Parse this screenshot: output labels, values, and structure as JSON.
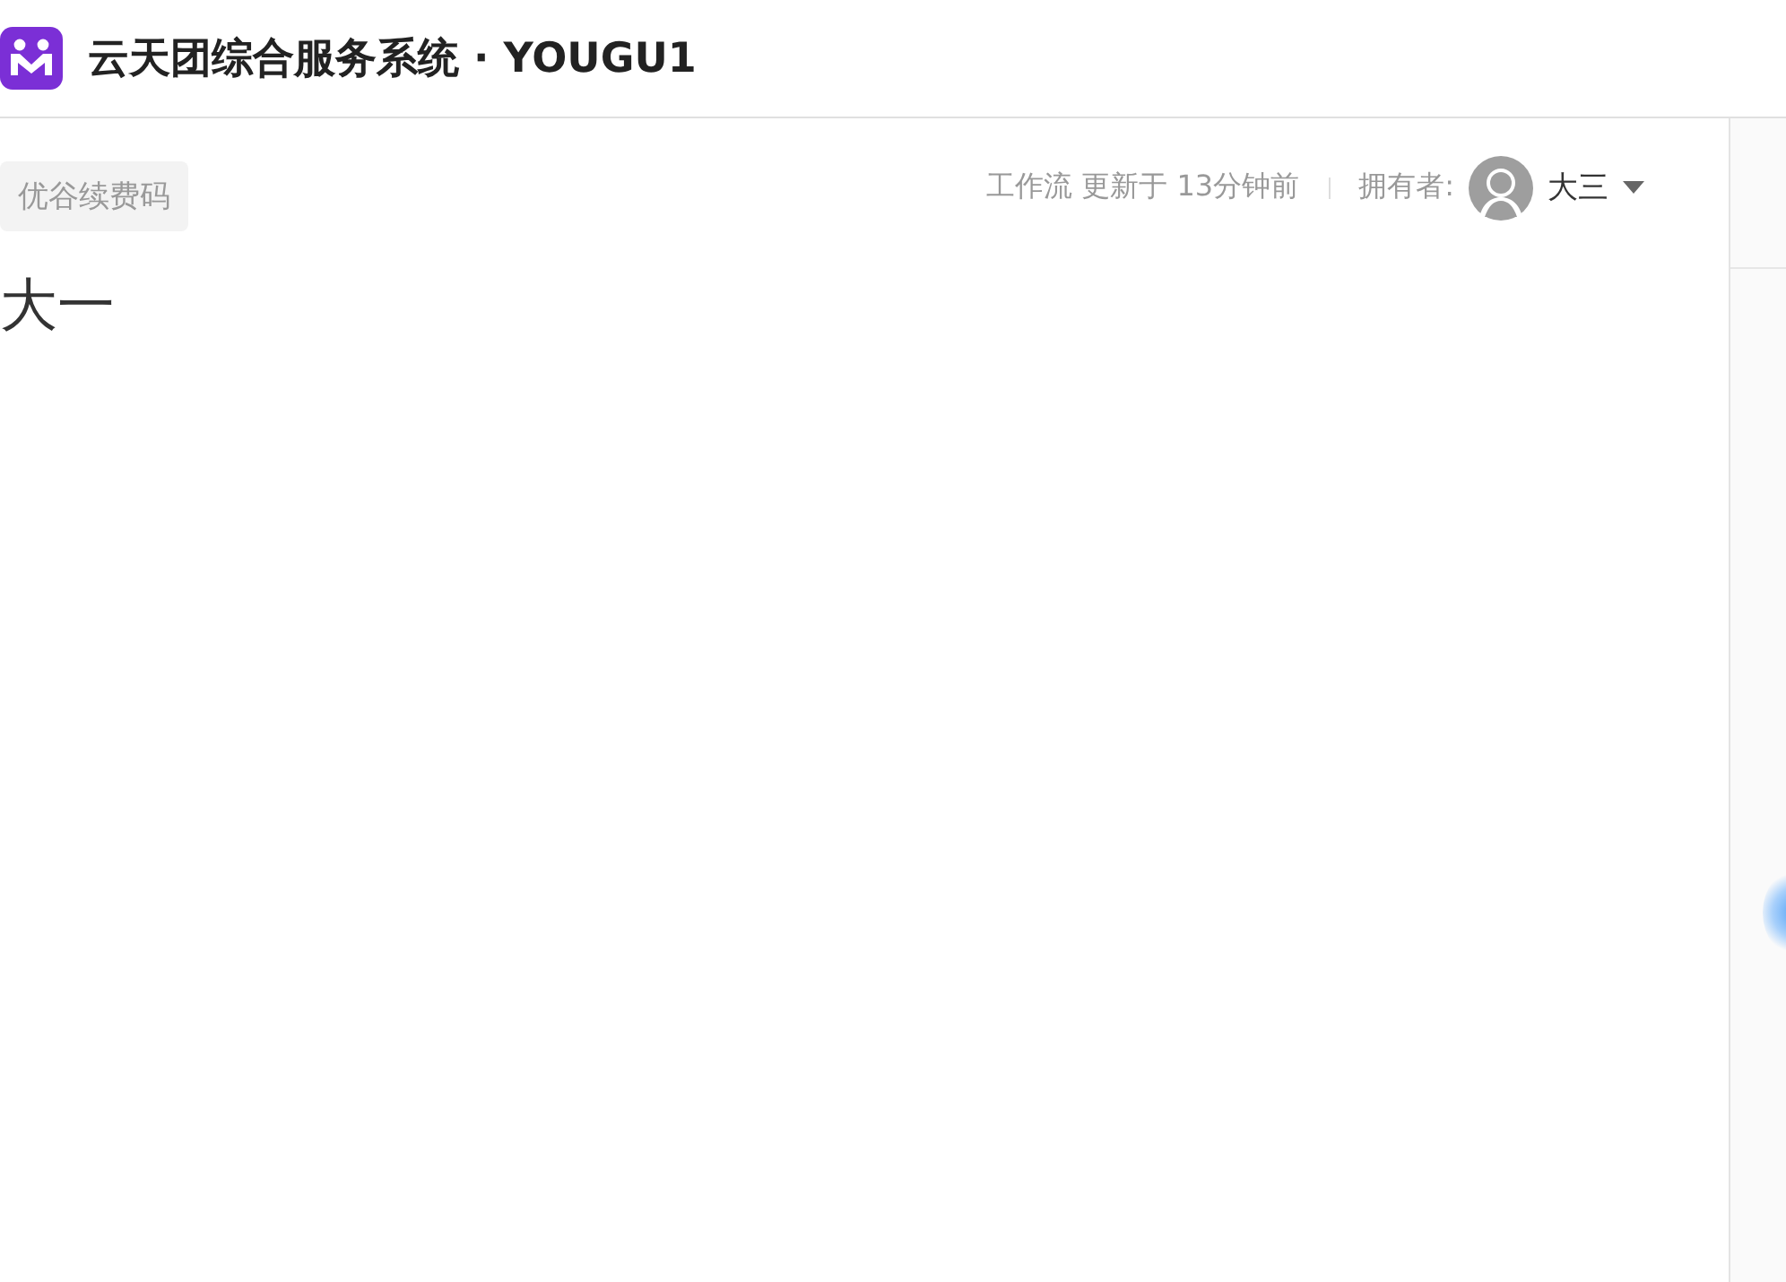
{
  "header": {
    "title": "云天团综合服务系统 · YOUGU1"
  },
  "document": {
    "tag": "优谷续费码",
    "meta": "工作流 更新于 13分钟前",
    "owner_label": "拥有者:",
    "owner_name": "大三",
    "title": "大一"
  }
}
